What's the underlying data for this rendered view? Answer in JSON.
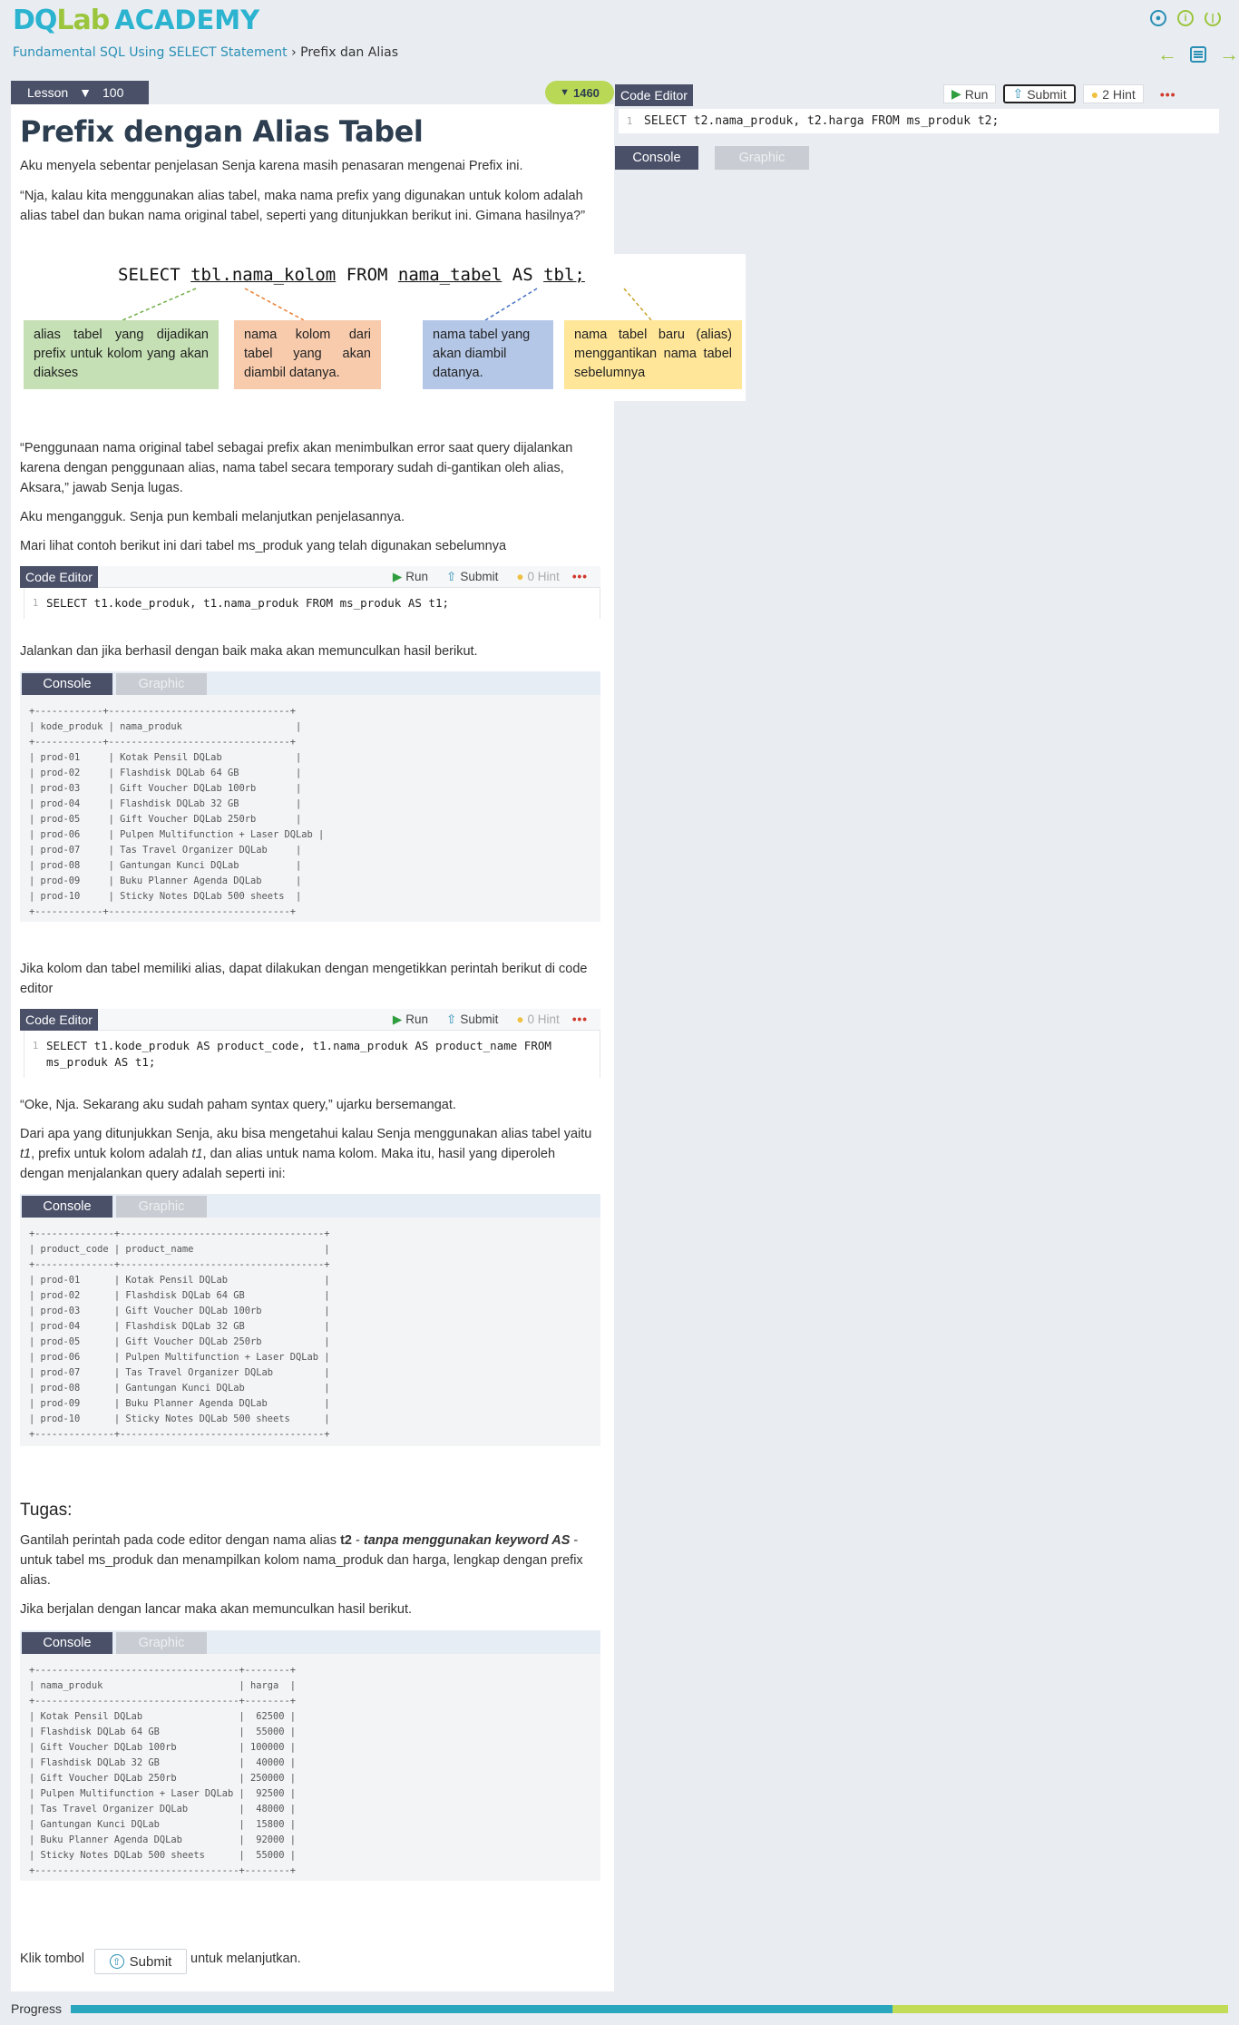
{
  "brand": {
    "logo_a": "DQ",
    "logo_b": "Lab",
    "logo_c": "ACADEMY"
  },
  "breadcrumb": {
    "course": "Fundamental SQL Using SELECT Statement",
    "sep": " › ",
    "page": "Prefix dan Alias"
  },
  "lesson_header": {
    "tab_label": "Lesson",
    "xp": "100",
    "score": "1460"
  },
  "lesson": {
    "title": "Prefix dengan Alias Tabel",
    "p1": "Aku menyela sebentar penjelasan Senja karena masih penasaran mengenai Prefix ini.",
    "p2": "“Nja, kalau kita menggunakan alias tabel, maka nama prefix yang digunakan untuk kolom adalah alias tabel dan bukan nama original tabel, seperti yang ditunjukkan berikut ini. Gimana hasilnya?”",
    "diagram": {
      "code_select": "SELECT",
      "code_tbl_col": "tbl.nama_kolom",
      "code_from": "FROM",
      "code_table": "nama_tabel",
      "code_as": "AS",
      "code_alias": "tbl;",
      "box1": "alias tabel yang dijadikan prefix untuk kolom yang akan diakses",
      "box2": "nama kolom dari tabel yang akan diambil datanya.",
      "box3": "nama tabel yang akan diambil datanya.",
      "box4": "nama tabel baru (alias) menggantikan nama tabel sebelumnya",
      "colors": {
        "box1": "#c5e0b4",
        "box2": "#f8cbad",
        "box3": "#b4c7e7",
        "box4": "#ffe699"
      }
    },
    "p3": "“Penggunaan nama original tabel sebagai prefix akan menimbulkan error saat query dijalankan karena dengan penggunaan alias, nama tabel secara temporary sudah di-gantikan oleh alias, Aksara,” jawab Senja lugas.",
    "p4": "Aku mengangguk. Senja pun kembali melanjutkan penjelasannya.",
    "p5": "Mari lihat contoh berikut ini dari tabel ms_produk yang telah digunakan sebelumnya",
    "p6": "Jalankan dan jika berhasil dengan baik maka akan memunculkan hasil berikut.",
    "p7": "Jika kolom dan tabel memiliki alias, dapat dilakukan dengan mengetikkan perintah berikut di code editor",
    "p8": "“Oke, Nja. Sekarang aku sudah paham syntax query,” ujarku bersemangat.",
    "p9_a": "Dari apa yang ditunjukkan Senja, aku bisa mengetahui kalau Senja menggunakan alias tabel yaitu ",
    "p9_t1": "t1",
    "p9_b": ", prefix untuk kolom adalah ",
    "p9_t1b": "t1",
    "p9_c": ", dan alias untuk nama kolom. Maka itu, hasil yang diperoleh dengan menjalankan query adalah seperti ini:",
    "task_title": "Tugas:",
    "task_a": "Gantilah perintah pada code editor dengan nama alias ",
    "task_t2": "t2",
    "task_b": " - ",
    "task_c": "tanpa menggunakan keyword AS",
    "task_d": " - untuk tabel ms_produk dan menampilkan kolom nama_produk dan harga, lengkap dengan prefix alias.",
    "task_p2": "Jika berjalan dengan lancar maka akan memunculkan hasil berikut.",
    "closing_a": "Klik tombol",
    "closing_b": "untuk melanjutkan."
  },
  "editor_ui": {
    "tab": "Code Editor",
    "run": "Run",
    "submit": "Submit",
    "hint_zero": "0 Hint",
    "hint_two": "2 Hint",
    "more": "•••",
    "line_no": "1",
    "console": "Console",
    "graphic": "Graphic"
  },
  "code_examples": {
    "ex1": "SELECT t1.kode_produk, t1.nama_produk FROM ms_produk AS t1;",
    "ex2": "SELECT t1.kode_produk AS product_code, t1.nama_produk AS product_name FROM\nms_produk AS t1;"
  },
  "outputs": {
    "out1": "+------------+--------------------------------+\n| kode_produk | nama_produk                    |\n+------------+--------------------------------+\n| prod-01     | Kotak Pensil DQLab             |\n| prod-02     | Flashdisk DQLab 64 GB          |\n| prod-03     | Gift Voucher DQLab 100rb       |\n| prod-04     | Flashdisk DQLab 32 GB          |\n| prod-05     | Gift Voucher DQLab 250rb       |\n| prod-06     | Pulpen Multifunction + Laser DQLab |\n| prod-07     | Tas Travel Organizer DQLab     |\n| prod-08     | Gantungan Kunci DQLab          |\n| prod-09     | Buku Planner Agenda DQLab      |\n| prod-10     | Sticky Notes DQLab 500 sheets  |\n+------------+--------------------------------+",
    "out2": "+--------------+------------------------------------+\n| product_code | product_name                       |\n+--------------+------------------------------------+\n| prod-01      | Kotak Pensil DQLab                 |\n| prod-02      | Flashdisk DQLab 64 GB              |\n| prod-03      | Gift Voucher DQLab 100rb           |\n| prod-04      | Flashdisk DQLab 32 GB              |\n| prod-05      | Gift Voucher DQLab 250rb           |\n| prod-06      | Pulpen Multifunction + Laser DQLab |\n| prod-07      | Tas Travel Organizer DQLab         |\n| prod-08      | Gantungan Kunci DQLab              |\n| prod-09      | Buku Planner Agenda DQLab          |\n| prod-10      | Sticky Notes DQLab 500 sheets      |\n+--------------+------------------------------------+",
    "out3": "+------------------------------------+--------+\n| nama_produk                        | harga  |\n+------------------------------------+--------+\n| Kotak Pensil DQLab                 |  62500 |\n| Flashdisk DQLab 64 GB              |  55000 |\n| Gift Voucher DQLab 100rb           | 100000 |\n| Flashdisk DQLab 32 GB              |  40000 |\n| Gift Voucher DQLab 250rb           | 250000 |\n| Pulpen Multifunction + Laser DQLab |  92500 |\n| Tas Travel Organizer DQLab         |  48000 |\n| Gantungan Kunci DQLab              |  15800 |\n| Buku Planner Agenda DQLab          |  92000 |\n| Sticky Notes DQLab 500 sheets      |  55000 |\n+------------------------------------+--------+"
  },
  "right_editor": {
    "code": "SELECT t2.nama_produk, t2.harga FROM ms_produk t2;"
  },
  "progress": {
    "label": "Progress",
    "fraction": 0.71
  }
}
